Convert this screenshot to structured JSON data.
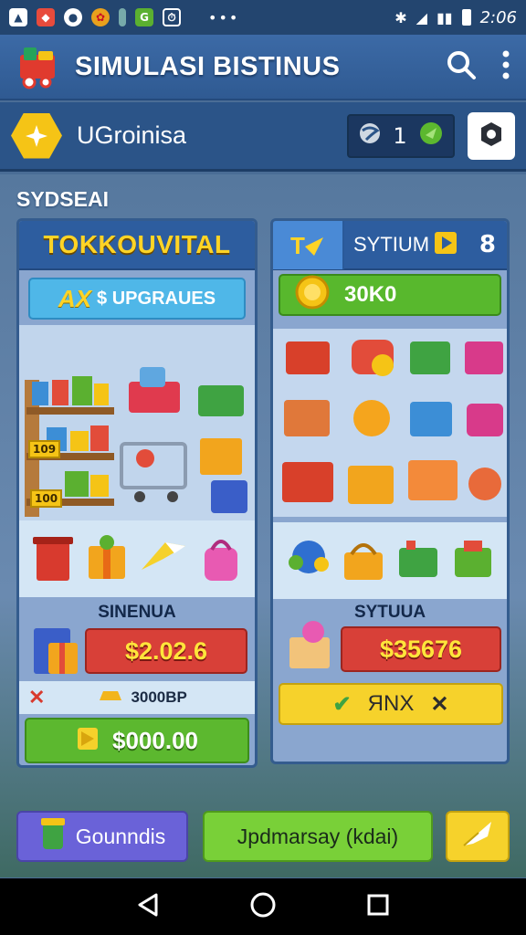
{
  "status_bar": {
    "time": "2:06"
  },
  "app_bar": {
    "title": "SIMULASI BISTINUS"
  },
  "user": {
    "name": "UGroinisa",
    "coins": "1"
  },
  "main": {
    "section_label": "SYDSEAI",
    "left_panel": {
      "title": "TOKKOUVITAL",
      "upgrade_prefix": "AX",
      "upgrade_label": "$ UPGRAUES",
      "shelf_tag_1": "109",
      "shelf_tag_2": "100",
      "item_name": "SINENUA",
      "price": "$2.02.6",
      "sub_value": "3000BP",
      "buy_label": "$000.00"
    },
    "right_panel": {
      "tab_label": "SYTIUM",
      "tab_count": "8",
      "coin_label": "30K0",
      "item_name": "SYTUUA",
      "price": "$35676",
      "action_label": "ЯNX"
    }
  },
  "bottom": {
    "left_label": "Gounndis",
    "center_label": "Jpdmarsay (kdai)"
  },
  "colors": {
    "accent_yellow": "#ffd426",
    "accent_green": "#58b82d",
    "accent_red": "#d84038",
    "primary_blue": "#2d5d9f"
  }
}
